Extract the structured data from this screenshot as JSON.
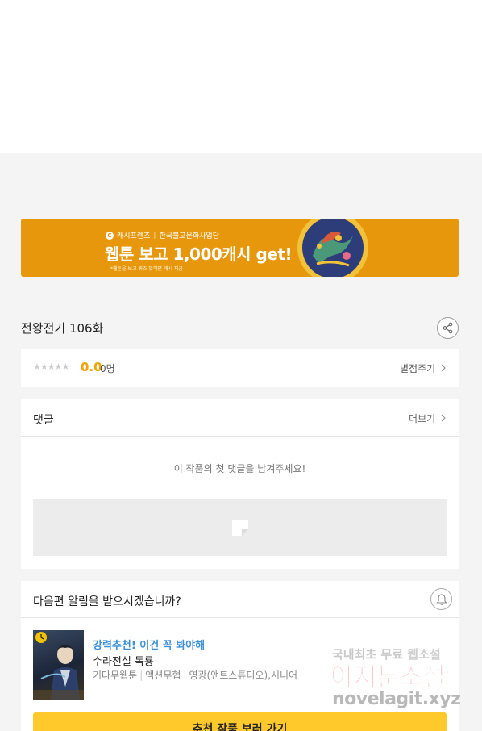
{
  "banner": {
    "brand_logo": "C",
    "brand_name": "캐시프렌즈",
    "brand_partner": "한국불교문화사업단",
    "headline": "웹툰 보고 1,000캐시 get!",
    "note": "*웹툰을 보고 퀴즈 맞히면 캐시 지급",
    "background_color": "#e6970c"
  },
  "episode": {
    "title": "전왕전기 106화",
    "share_icon": "share-icon"
  },
  "rating": {
    "stars": "★★★★★",
    "score": "0.0",
    "count": "0명",
    "rate_link": "별점주기",
    "score_color": "#f0a400"
  },
  "comments": {
    "title": "댓글",
    "more_link": "더보기",
    "empty_text": "이 작품의 첫 댓글을 남겨주세요!"
  },
  "notice": {
    "title": "다음편 알림을 받으시겠습니까?",
    "bell_icon": "bell-icon",
    "recommendation": {
      "tag": "강력추천! 이건 꼭 봐야해",
      "title": "수라전설 독룡",
      "author": "기다무웹툰",
      "genre": "액션무협",
      "publisher": "영광(앤트스튜디오),시니어"
    },
    "cta": "추천 작품 보러 가기"
  },
  "watermark": {
    "line1_a": "국내최초 무료",
    "line1_b": "웹소설",
    "line2": "아지툰소설",
    "line3": "novelagit.xyz"
  }
}
